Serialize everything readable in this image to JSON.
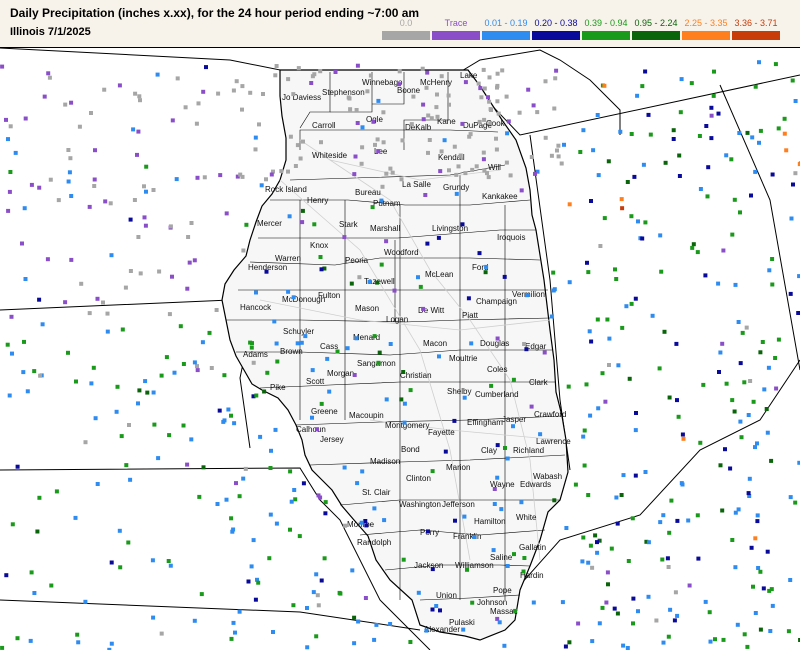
{
  "header": {
    "title": "Daily Precipitation (inches  x.xx),  for the 24 hour period ending ~7:00 am",
    "subtitle": "Illinois 7/1/2025"
  },
  "legend": [
    {
      "label": "0.0",
      "color": "#a6a6a6"
    },
    {
      "label": "Trace",
      "color": "#8a4fc8"
    },
    {
      "label": "0.01 - 0.19",
      "color": "#2e8cf0"
    },
    {
      "label": "0.20 - 0.38",
      "color": "#0a0a9a"
    },
    {
      "label": "0.39 - 0.94",
      "color": "#1a9a1a"
    },
    {
      "label": "0.95 - 2.24",
      "color": "#0a640a"
    },
    {
      "label": "2.25 - 3.35",
      "color": "#ff7f1e"
    },
    {
      "label": "3.36 - 3.71",
      "color": "#c83c0a"
    }
  ],
  "counties": [
    "Jo Daviess",
    "Stephenson",
    "Winnebago",
    "Boone",
    "McHenry",
    "Lake",
    "Carroll",
    "Ogle",
    "DeKalb",
    "Kane",
    "DuPage",
    "Cook",
    "Whiteside",
    "Lee",
    "Kendall",
    "Will",
    "Rock Island",
    "Henry",
    "Bureau",
    "La Salle",
    "Grundy",
    "Kankakee",
    "Mercer",
    "Stark",
    "Putnam",
    "Marshall",
    "Livingston",
    "Iroquois",
    "Knox",
    "Peoria",
    "Woodford",
    "Henderson",
    "Warren",
    "Ford",
    "McLean",
    "Tazewell",
    "Hancock",
    "McDonough",
    "Fulton",
    "Vermilion",
    "Champaign",
    "Schuyler",
    "Mason",
    "De Witt",
    "Logan",
    "Piatt",
    "Menard",
    "Adams",
    "Brown",
    "Cass",
    "Macon",
    "Douglas",
    "Edgar",
    "Sangamon",
    "Morgan",
    "Moultrie",
    "Coles",
    "Christian",
    "Scott",
    "Pike",
    "Clark",
    "Shelby",
    "Cumberland",
    "Greene",
    "Macoupin",
    "Crawford",
    "Montgomery",
    "Jasper",
    "Calhoun",
    "Jersey",
    "Fayette",
    "Effingham",
    "Lawrence",
    "Richland",
    "Clay",
    "Madison",
    "Bond",
    "Marion",
    "Wabash",
    "St. Clair",
    "Clinton",
    "Wayne",
    "Edwards",
    "Washington",
    "Jefferson",
    "White",
    "Monroe",
    "Hamilton",
    "Randolph",
    "Perry",
    "Franklin",
    "Gallatin",
    "Saline",
    "Jackson",
    "Williamson",
    "Hardin",
    "Union",
    "Johnson",
    "Pope",
    "Pulaski",
    "Massac",
    "Alexander"
  ]
}
